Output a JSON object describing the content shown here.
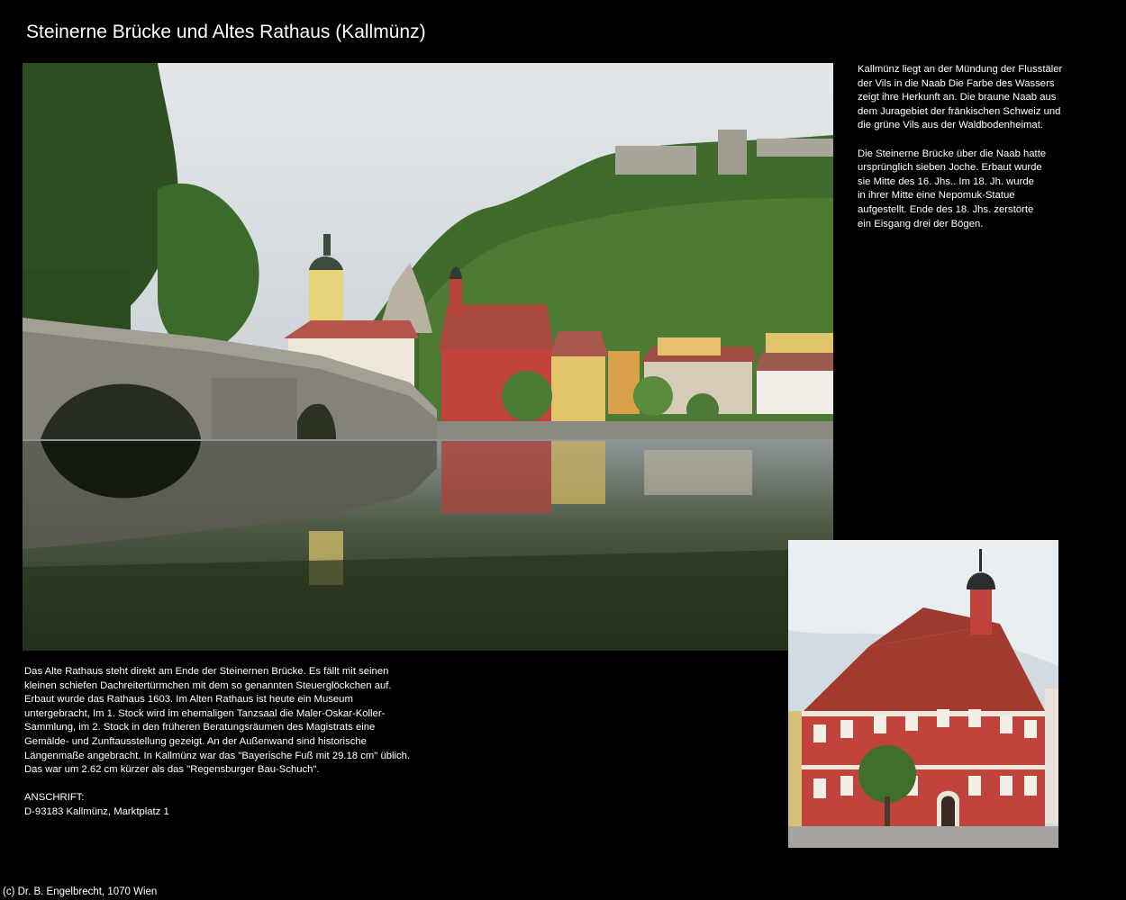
{
  "page": {
    "title": "Steinerne Brücke und Altes Rathaus (Kallmünz)",
    "footer": "(c) Dr. B. Engelbrecht, 1070 Wien"
  },
  "side_text": {
    "paragraph_1": "Kallmünz liegt an der Mündung der Flusstäler\nder Vils in die Naab Die Farbe des Wassers\nzeigt ihre Herkunft an. Die braune Naab aus\ndem Juragebiet der fränkischen Schweiz und\ndie grüne Vils aus der Waldbodenheimat.",
    "paragraph_2": "Die Steinerne Brücke über die Naab hatte\nursprünglich sieben Joche. Erbaut wurde\nsie Mitte des 16. Jhs.. Im 18. Jh. wurde\nin ihrer Mitte eine Nepomuk-Statue\naufgestellt. Ende des 18. Jhs. zerstörte\nein Eisgang drei der Bögen."
  },
  "bottom_text": {
    "paragraph_1": "Das Alte Rathaus steht direkt am Ende der Steinernen Brücke. Es fällt mit seinen\nkleinen schiefen Dachreitertürmchen mit dem so genannten Steuerglöckchen auf.\nErbaut wurde das Rathaus 1603. Im Alten Rathaus ist heute ein Museum\nuntergebracht, Im 1. Stock wird im ehemaligen Tanzsaal die Maler-Oskar-Koller-\nSammlung, im 2. Stock in den früheren Beratungsräumen des Magistrats eine\nGemälde- und Zunftausstellung gezeigt. An der Außenwand sind historische\nLängenmaße angebracht. In Kallmünz war das \"Bayerische Fuß mit 29.18 cm\" üblich.\nDas war um 2.62 cm kürzer als das \"Regensburger Bau-Schuch\".",
    "address_label": "ANSCHRIFT:",
    "address": "D-93183 Kallmünz, Marktplatz 1"
  },
  "colors": {
    "background": "#000000",
    "text": "#ffffff",
    "rathaus_red": "#c0443b",
    "foliage": "#3d6b2a",
    "sky": "#d7dde2",
    "stone": "#7d7d77"
  }
}
